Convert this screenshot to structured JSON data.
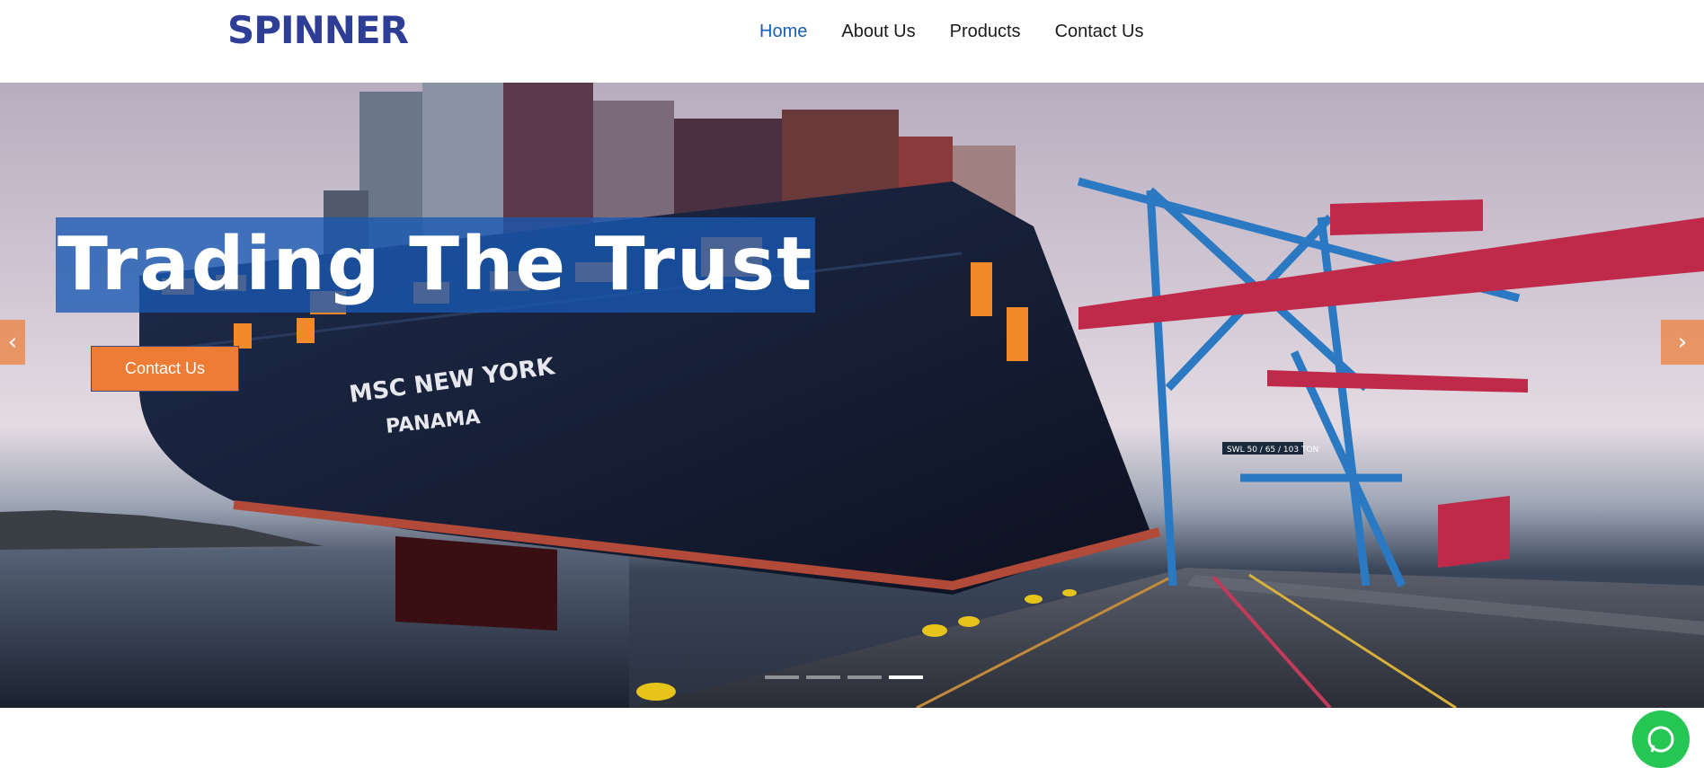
{
  "header": {
    "logo": "SPINNER",
    "nav": [
      {
        "label": "Home",
        "active": true
      },
      {
        "label": "About Us",
        "active": false
      },
      {
        "label": "Products",
        "active": false
      },
      {
        "label": "Contact Us",
        "active": false
      }
    ]
  },
  "hero": {
    "title": "Trading The Trust",
    "button_label": "Contact Us",
    "ship_name": "MSC NEW YORK",
    "ship_port": "PANAMA",
    "crane_label": "SWL 50 / 65 / 103 TON",
    "prev_icon": "chevron-left-icon",
    "next_icon": "chevron-right-icon",
    "slides_total": 4,
    "active_slide": 4
  },
  "colors": {
    "brand": "#2e3d96",
    "nav_active": "#1a5fb4",
    "accent": "#ee7c34",
    "title_bg": "#1858b2",
    "whatsapp": "#25c653"
  },
  "floating": {
    "icon": "whatsapp-icon"
  }
}
